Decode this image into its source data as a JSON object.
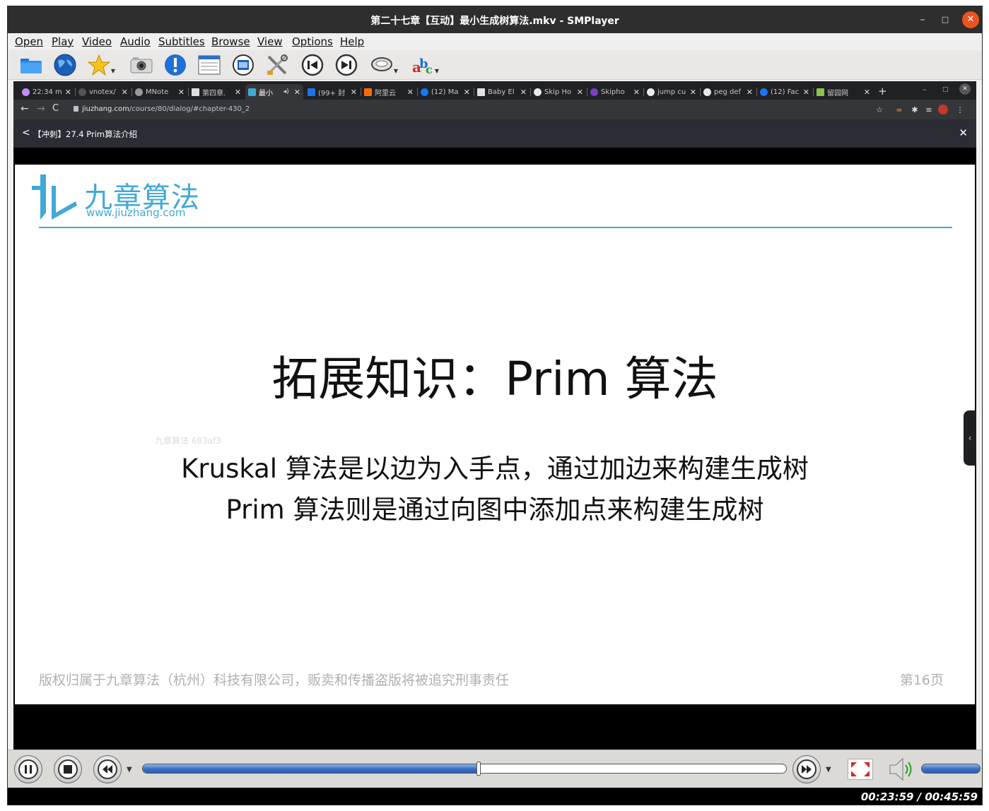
{
  "window": {
    "title": "第二十七章【互动】最小生成树算法.mkv - SMPlayer",
    "min": "–",
    "max": "□",
    "close": "✕"
  },
  "menu": [
    "Open",
    "Play",
    "Video",
    "Audio",
    "Subtitles",
    "Browse",
    "View",
    "Options",
    "Help"
  ],
  "toolbar": {
    "icons": [
      "open-folder-icon",
      "globe-icon",
      "favorites-star-icon",
      "screenshot-camera-icon",
      "info-icon",
      "playlist-icon",
      "video-equalizer-icon",
      "preferences-tools-icon",
      "previous-icon",
      "next-icon",
      "audio-track-icon",
      "subtitle-abc-icon"
    ]
  },
  "browser": {
    "tabs": [
      {
        "label": "22:34 m",
        "color": "#c58af9"
      },
      {
        "label": "vnotex/",
        "color": "#444"
      },
      {
        "label": "MNote",
        "color": "#999"
      },
      {
        "label": "第四章.",
        "color": "#ddd"
      },
      {
        "label": "最小",
        "color": "#41a9d6",
        "active": true
      },
      {
        "label": "(99+ 封",
        "color": "#1a73e8"
      },
      {
        "label": "阿里云",
        "color": "#ff6a00"
      },
      {
        "label": "(12) Ma",
        "color": "#1877f2"
      },
      {
        "label": "Baby El",
        "color": "#e0e0e0"
      },
      {
        "label": "Skip Ho",
        "color": "#e8eaed"
      },
      {
        "label": "Skipho",
        "color": "#7b3fc6"
      },
      {
        "label": "jump cu",
        "color": "#e8eaed"
      },
      {
        "label": "peg def",
        "color": "#e8eaed"
      },
      {
        "label": "(12) Fac",
        "color": "#1877f2"
      },
      {
        "label": "留园网",
        "color": "#8bc34a"
      }
    ],
    "new_tab": "+",
    "url_host": "jiuzhang.com",
    "url_path": "/course/80/dialog/#chapter-430_2",
    "page_header": {
      "back": "<",
      "lesson_title": "【冲刺】27.4 Prim算法介绍",
      "close": "✕"
    }
  },
  "slide": {
    "logo_name": "九章算法",
    "logo_url": "www.jiuzhang.com",
    "title": "拓展知识：Prim 算法",
    "watermark": "九章算法 683af3",
    "line1": "Kruskal 算法是以边为入手点，通过加边来构建生成树",
    "line2": "Prim 算法则是通过向图中添加点来构建生成树",
    "copyright": "版权归属于九章算法（杭州）科技有限公司，贩卖和传播盗版将被追究刑事责任",
    "page": "第16页"
  },
  "player": {
    "progress": 0.522,
    "volume": 1.0,
    "time": "00:23:59 / 00:45:59"
  }
}
